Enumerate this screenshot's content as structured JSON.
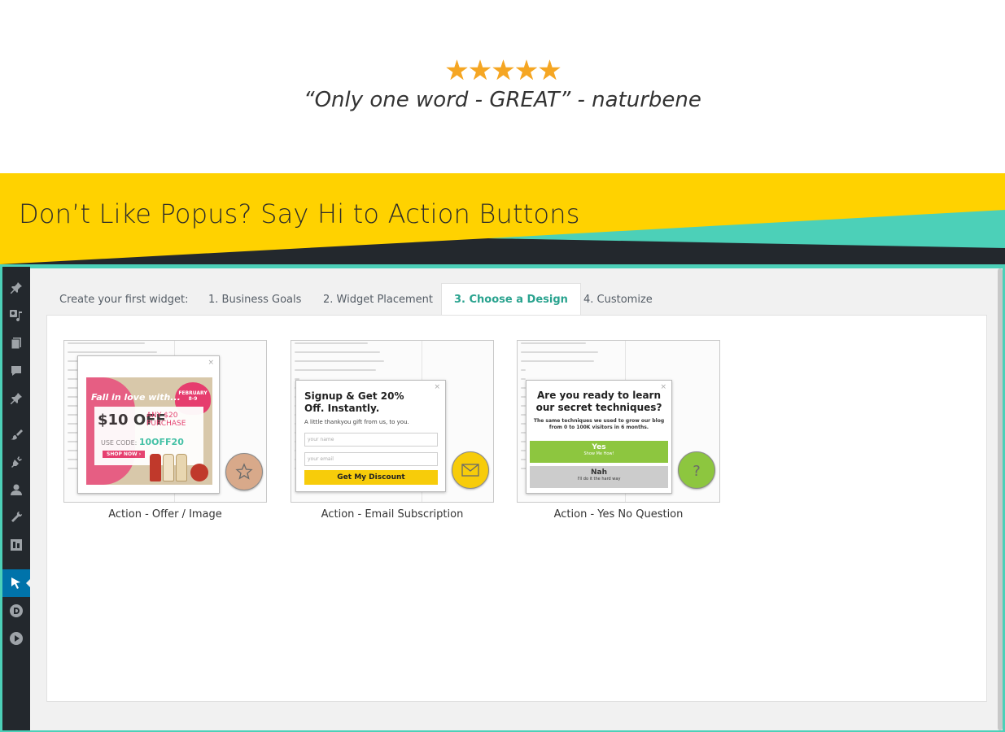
{
  "testimonial": {
    "rating": 5,
    "stars": [
      "★",
      "★",
      "★",
      "★",
      "★"
    ],
    "quote": "“Only one word - GREAT” - naturbene",
    "star_color": "#f5a623"
  },
  "banner": {
    "title": "Don’t Like Popus? Say Hi to Action Buttons",
    "yellow": "#ffd200",
    "teal": "#4cd0b8",
    "dark": "#23282d"
  },
  "wizard": {
    "intro": "Create your first widget:",
    "tabs": [
      {
        "label": "1. Business Goals",
        "active": false
      },
      {
        "label": "2. Widget Placement",
        "active": false
      },
      {
        "label": "3. Choose a Design",
        "active": true
      },
      {
        "label": "4. Customize",
        "active": false
      }
    ],
    "accent": "#2aa38f"
  },
  "designs": [
    {
      "caption": "Action - Offer / Image",
      "offer": {
        "fall": "Fall in love with...",
        "amount": "$10 OFF",
        "any": "ANY $20 PURCHASE",
        "code_label": "USE CODE:",
        "code": "10OFF20",
        "shop": "SHOP NOW ›",
        "badge": "FEBRUARY 8-9"
      },
      "button_color": "#d8a98a",
      "icon": "star-badge-icon"
    },
    {
      "caption": "Action - Email Subscription",
      "title": "Signup & Get 20% Off. Instantly.",
      "subtitle": "A little thankyou gift from us, to you.",
      "name_placeholder": "your name",
      "email_placeholder": "your email",
      "cta": "Get My Discount",
      "button_color": "#f7cc0a",
      "icon": "envelope-icon"
    },
    {
      "caption": "Action - Yes No Question",
      "title": "Are you ready to learn our secret techniques?",
      "subtitle": "The same techniques we used to grow our blog from 0 to 100K visitors in 6 months.",
      "yes": "Yes",
      "yes_sub": "Show Me How!",
      "no": "Nah",
      "no_sub": "I'll do it the hard way",
      "yes_color": "#8dc63f",
      "no_color": "#cccccc",
      "button_color": "#8dc63f",
      "icon": "question-icon"
    }
  ],
  "sidebar_icons": [
    "pin-icon",
    "media-icon",
    "pages-icon",
    "comments-icon",
    "pin-icon",
    "appearance-icon",
    "plugins-icon",
    "users-icon",
    "tools-icon",
    "settings-icon",
    "pointer-icon",
    "d-logo-icon",
    "play-icon"
  ]
}
